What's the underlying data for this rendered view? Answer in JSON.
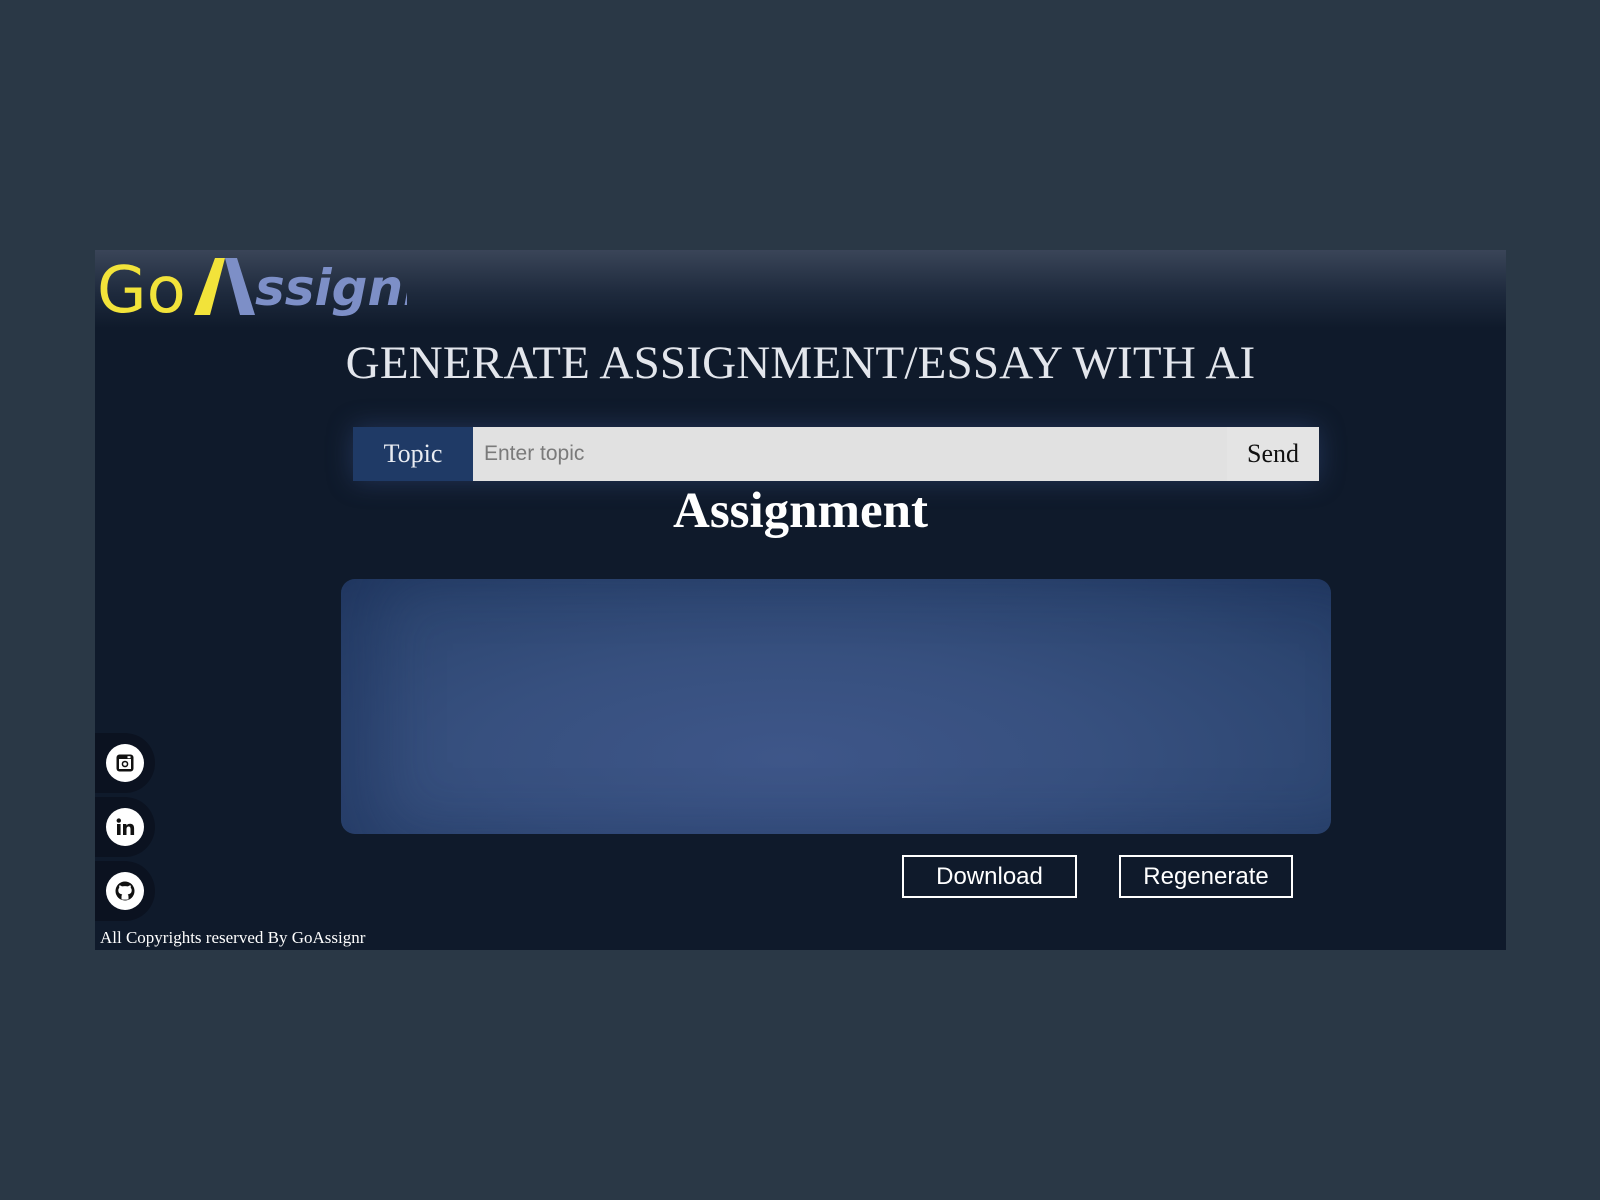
{
  "brand": {
    "logo_part1": "Go",
    "logo_part2": "ssignr",
    "colors": {
      "yellow": "#f2e33a",
      "blue": "#7d8fc7"
    }
  },
  "page": {
    "title": "GENERATE ASSIGNMENT/ESSAY WITH AI",
    "section_heading": "Assignment"
  },
  "topic_form": {
    "label": "Topic",
    "placeholder": "Enter topic",
    "value": "",
    "send_label": "Send"
  },
  "actions": {
    "download_label": "Download",
    "regenerate_label": "Regenerate"
  },
  "social": [
    {
      "name": "instagram-icon"
    },
    {
      "name": "linkedin-icon"
    },
    {
      "name": "github-icon"
    }
  ],
  "footer": {
    "copyright": "All Copyrights reserved By GoAssignr"
  },
  "theme": {
    "background": "#2a3846",
    "app_background": "#0f1a2b",
    "topic_label_bg": "#1f3a66",
    "output_box": "#3a5283"
  }
}
